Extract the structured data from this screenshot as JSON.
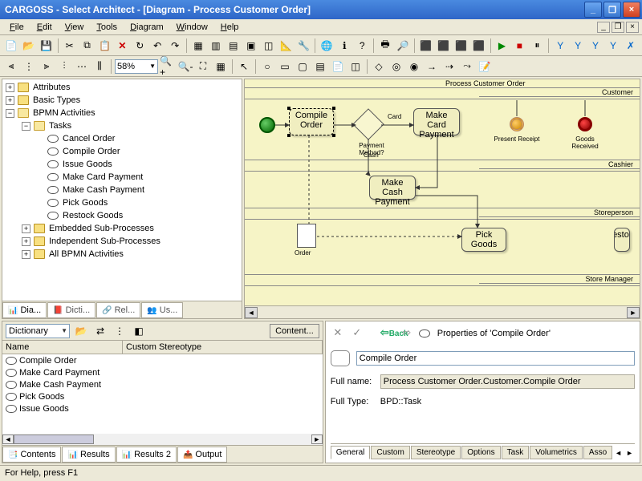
{
  "title": "CARGOSS - Select Architect - [Diagram - Process Customer Order]",
  "menus": {
    "file": "File",
    "edit": "Edit",
    "view": "View",
    "tools": "Tools",
    "diagram": "Diagram",
    "window": "Window",
    "help": "Help"
  },
  "zoom": "58%",
  "tree": {
    "attributes": "Attributes",
    "basic": "Basic Types",
    "bpmn": "BPMN Activities",
    "tasks": "Tasks",
    "t1": "Cancel Order",
    "t2": "Compile Order",
    "t3": "Issue Goods",
    "t4": "Make Card Payment",
    "t5": "Make Cash Payment",
    "t6": "Pick Goods",
    "t7": "Restock Goods",
    "emb": "Embedded Sub-Processes",
    "ind": "Independent Sub-Processes",
    "all": "All BPMN Activities"
  },
  "tree_tabs": {
    "dia": "Dia...",
    "dict": "Dicti...",
    "rel": "Rel...",
    "us": "Us..."
  },
  "diagram": {
    "pool": "Process Customer Order",
    "lanes": {
      "customer": "Customer",
      "cashier": "Cashier",
      "store": "Storeperson",
      "mgr": "Store Manager"
    },
    "tasks": {
      "compile": "Compile Order",
      "mcard": "Make Card Payment",
      "mcash": "Make Cash Payment",
      "pick": "Pick Goods",
      "restock": "Restock"
    },
    "labels": {
      "pm": "Payment Method?",
      "card": "Card",
      "cash": "Cash",
      "present": "Present Receipt",
      "goods": "Goods Received",
      "order": "Order"
    }
  },
  "dict": {
    "combo": "Dictionary",
    "contentBtn": "Content...",
    "cols": {
      "name": "Name",
      "stereo": "Custom Stereotype"
    },
    "rows": [
      "Compile Order",
      "Make Card Payment",
      "Make Cash Payment",
      "Pick Goods",
      "Issue Goods"
    ],
    "tabs": {
      "contents": "Contents",
      "results": "Results",
      "results2": "Results 2",
      "output": "Output"
    }
  },
  "props": {
    "back": "Back",
    "title": "Properties of 'Compile Order'",
    "name": "Compile Order",
    "fullname_label": "Full name:",
    "fullname": "Process Customer Order.Customer.Compile Order",
    "fulltype_label": "Full Type:",
    "fulltype": "BPD::Task",
    "tabs": [
      "General",
      "Custom",
      "Stereotype",
      "Options",
      "Task",
      "Volumetrics",
      "Asso"
    ]
  },
  "status": "For Help, press F1"
}
